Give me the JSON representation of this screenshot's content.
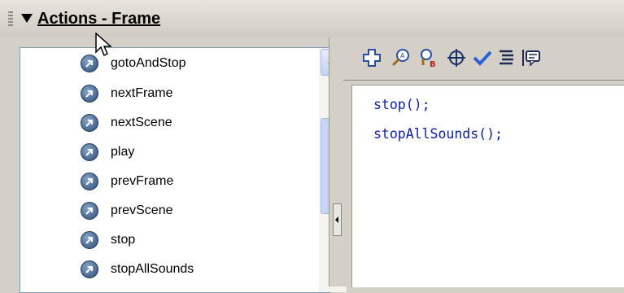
{
  "panel": {
    "title": "Actions - Frame"
  },
  "actions_list": {
    "items": [
      {
        "label": "gotoAndStop"
      },
      {
        "label": "nextFrame"
      },
      {
        "label": "nextScene"
      },
      {
        "label": "play"
      },
      {
        "label": "prevFrame"
      },
      {
        "label": "prevScene"
      },
      {
        "label": "stop"
      },
      {
        "label": "stopAllSounds"
      }
    ]
  },
  "toolbar": {
    "buttons": [
      {
        "icon": "add-icon"
      },
      {
        "icon": "find-icon"
      },
      {
        "icon": "replace-icon"
      },
      {
        "icon": "target-icon"
      },
      {
        "icon": "check-syntax-icon"
      },
      {
        "icon": "auto-format-icon"
      },
      {
        "icon": "code-hint-icon"
      }
    ]
  },
  "script": {
    "lines": [
      "stop();",
      "stopAllSounds();"
    ]
  },
  "colors": {
    "code_text": "#0b1f9c",
    "panel_bg": "#d4d0c8",
    "scroll_thumb": "#b4c8f3"
  }
}
